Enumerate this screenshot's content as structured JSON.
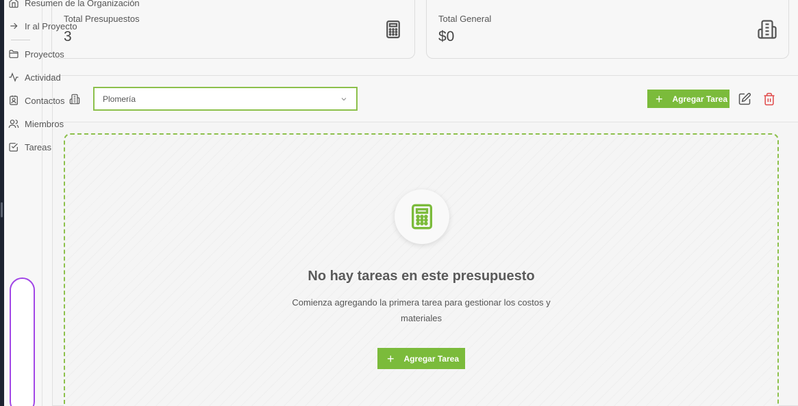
{
  "sidebar": {
    "items": [
      {
        "label": "Resumen de la Organización",
        "icon": "home-icon"
      },
      {
        "label": "Ir al Proyecto",
        "icon": "arrow-right-icon"
      },
      {
        "label": "Proyectos",
        "icon": "folder-icon"
      },
      {
        "label": "Actividad",
        "icon": "activity-icon"
      },
      {
        "label": "Contactos",
        "icon": "contact-icon"
      },
      {
        "label": "Miembros",
        "icon": "users-icon"
      },
      {
        "label": "Tareas",
        "icon": "check-square-icon"
      }
    ]
  },
  "stats": {
    "budgets": {
      "label": "Total Presupuestos",
      "value": "3",
      "icon": "calculator-icon"
    },
    "total": {
      "label": "Total General",
      "value": "$0",
      "icon": "building-icon"
    }
  },
  "budget": {
    "selected": "Plomería",
    "add_task_label": "Agregar Tarea",
    "edit_icon": "edit-icon",
    "delete_icon": "trash-icon"
  },
  "empty_state": {
    "title": "No hay tareas en este presupuesto",
    "description": "Comienza agregando la primera tarea para gestionar los costos y materiales",
    "button_label": "Agregar Tarea"
  },
  "colors": {
    "accent": "#7bbb3b",
    "danger": "#e04848",
    "focus": "#a146e6"
  }
}
